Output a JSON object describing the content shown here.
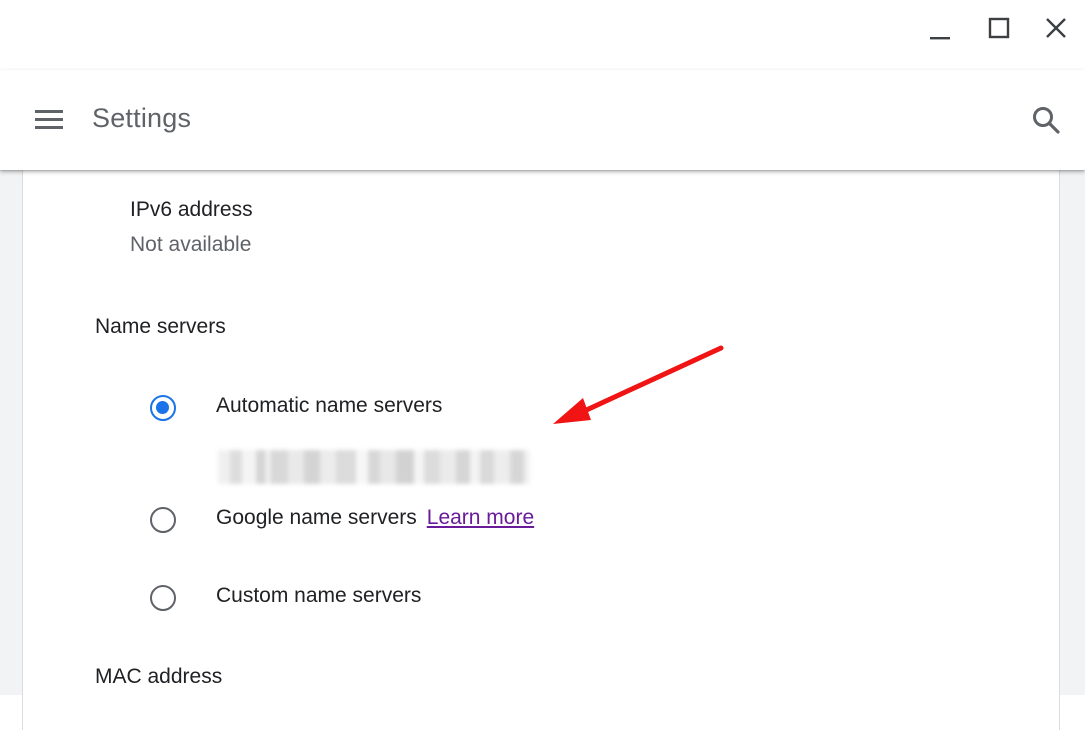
{
  "window": {
    "controls": [
      "minimize-icon",
      "maximize-icon",
      "close-icon"
    ]
  },
  "header": {
    "title": "Settings",
    "menu_icon": "hamburger-menu-icon",
    "search_icon": "search-icon"
  },
  "network": {
    "ipv6": {
      "label": "IPv6 address",
      "value": "Not available"
    },
    "name_servers": {
      "heading": "Name servers",
      "options": [
        {
          "label": "Automatic name servers",
          "selected": true
        },
        {
          "label": "Google name servers",
          "selected": false,
          "link": "Learn more"
        },
        {
          "label": "Custom name servers",
          "selected": false
        }
      ]
    },
    "mac": {
      "label": "MAC address"
    }
  },
  "colors": {
    "accent": "#1a73e8",
    "link": "#6a1b9a",
    "annotation": "#f01414",
    "secondary_text": "#5f6368"
  }
}
